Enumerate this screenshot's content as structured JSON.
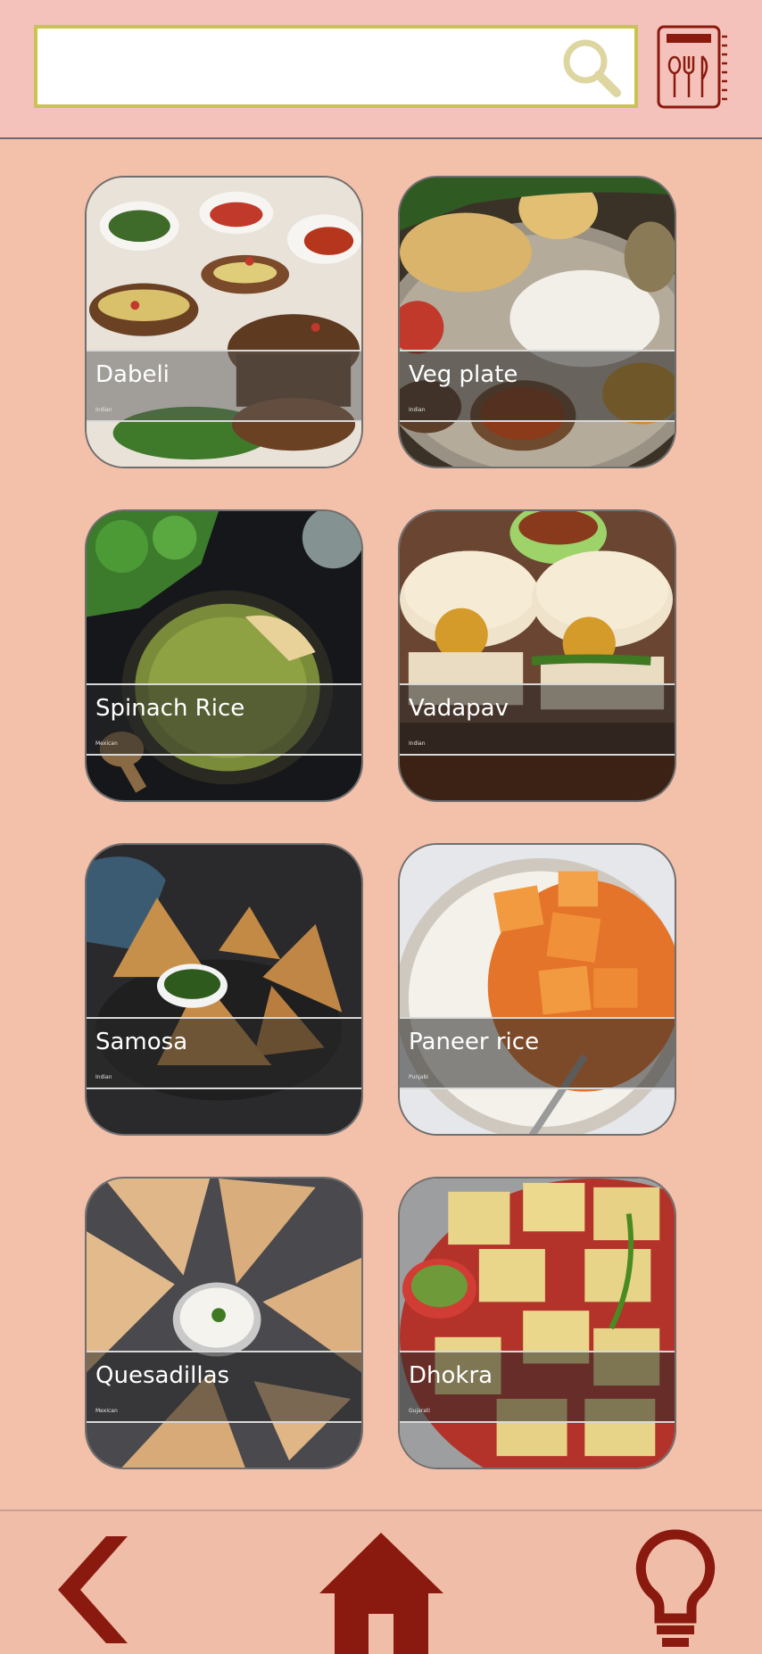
{
  "search": {
    "placeholder": "",
    "value": ""
  },
  "icons": {
    "search": "search-icon",
    "recipe_book": "recipe-book-icon",
    "back": "back-arrow-icon",
    "home": "home-icon",
    "tips": "lightbulb-icon"
  },
  "colors": {
    "header_bg": "#f4c2ba",
    "body_bg": "#f3c0aa",
    "search_border": "#c9c354",
    "accent_dark_red": "#8a1a0f"
  },
  "recipes": [
    {
      "name": "Dabeli",
      "cuisine": "Indian"
    },
    {
      "name": "Veg plate",
      "cuisine": "Indian"
    },
    {
      "name": "Spinach Rice",
      "cuisine": "Mexican"
    },
    {
      "name": "Vadapav",
      "cuisine": "Indian"
    },
    {
      "name": "Samosa",
      "cuisine": "Indian"
    },
    {
      "name": "Paneer rice",
      "cuisine": "Punjabi"
    },
    {
      "name": "Quesadillas",
      "cuisine": "Mexican"
    },
    {
      "name": "Dhokra",
      "cuisine": "Gujarati"
    }
  ]
}
